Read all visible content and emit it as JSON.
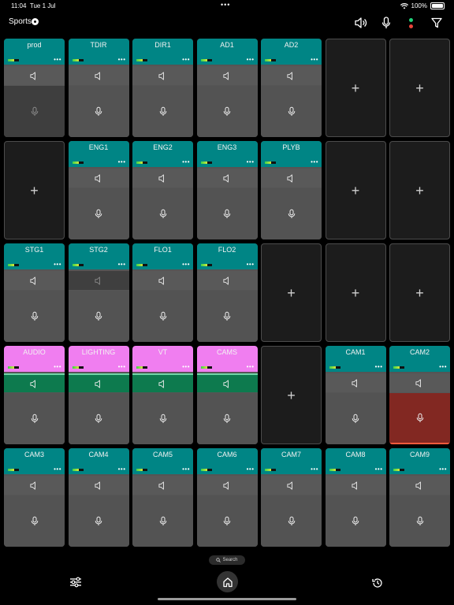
{
  "status_bar": {
    "time": "11:04",
    "date": "Tue 1 Jul",
    "dots": "•••",
    "battery": "100%"
  },
  "header": {
    "title": "Sports",
    "icons": [
      "speaker-icon",
      "microphone-icon",
      "status-dots-icon",
      "filter-icon"
    ]
  },
  "colors": {
    "teal": "#008585",
    "pink": "#f07ef0",
    "green": "#0d7a4e",
    "mic_active": "#822822"
  },
  "tiles": [
    {
      "type": "channel",
      "label": "prod",
      "color": "teal",
      "mic": "dim"
    },
    {
      "type": "channel",
      "label": "TDIR",
      "color": "teal"
    },
    {
      "type": "channel",
      "label": "DIR1",
      "color": "teal"
    },
    {
      "type": "channel",
      "label": "AD1",
      "color": "teal"
    },
    {
      "type": "channel",
      "label": "AD2",
      "color": "teal"
    },
    {
      "type": "empty"
    },
    {
      "type": "empty"
    },
    {
      "type": "empty"
    },
    {
      "type": "channel",
      "label": "ENG1",
      "color": "teal"
    },
    {
      "type": "channel",
      "label": "ENG2",
      "color": "teal"
    },
    {
      "type": "channel",
      "label": "ENG3",
      "color": "teal"
    },
    {
      "type": "channel",
      "label": "PLYB",
      "color": "teal"
    },
    {
      "type": "empty"
    },
    {
      "type": "empty"
    },
    {
      "type": "channel",
      "label": "STG1",
      "color": "teal"
    },
    {
      "type": "channel",
      "label": "STG2",
      "color": "teal",
      "spk": "dim"
    },
    {
      "type": "channel",
      "label": "FLO1",
      "color": "teal"
    },
    {
      "type": "channel",
      "label": "FLO2",
      "color": "teal"
    },
    {
      "type": "empty"
    },
    {
      "type": "empty"
    },
    {
      "type": "empty"
    },
    {
      "type": "channel",
      "label": "AUDIO",
      "color": "pink",
      "spk": "green"
    },
    {
      "type": "channel",
      "label": "LIGHTING",
      "color": "pink",
      "spk": "green"
    },
    {
      "type": "channel",
      "label": "VT",
      "color": "pink",
      "spk": "green"
    },
    {
      "type": "channel",
      "label": "CAMS",
      "color": "pink",
      "spk": "green"
    },
    {
      "type": "empty"
    },
    {
      "type": "channel",
      "label": "CAM1",
      "color": "teal"
    },
    {
      "type": "channel",
      "label": "CAM2",
      "color": "teal",
      "mic": "red"
    },
    {
      "type": "channel",
      "label": "CAM3",
      "color": "teal"
    },
    {
      "type": "channel",
      "label": "CAM4",
      "color": "teal"
    },
    {
      "type": "channel",
      "label": "CAM5",
      "color": "teal"
    },
    {
      "type": "channel",
      "label": "CAM6",
      "color": "teal"
    },
    {
      "type": "channel",
      "label": "CAM7",
      "color": "teal"
    },
    {
      "type": "channel",
      "label": "CAM8",
      "color": "teal"
    },
    {
      "type": "channel",
      "label": "CAM9",
      "color": "teal"
    }
  ],
  "more_label": "•••",
  "search": {
    "label": "Search"
  },
  "bottom": {
    "icons": [
      "sliders-icon",
      "home-icon",
      "history-icon"
    ]
  }
}
